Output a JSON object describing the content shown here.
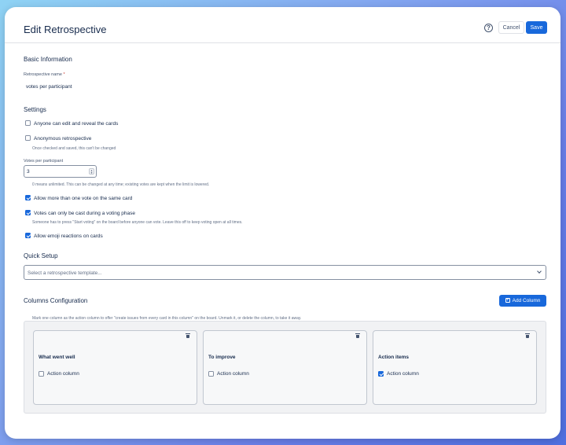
{
  "header": {
    "title": "Edit Retrospective",
    "help_icon": "?",
    "cancel_label": "Cancel",
    "save_label": "Save"
  },
  "basic": {
    "section_title": "Basic Information",
    "name_label": "Retrospective name",
    "required_mark": "*",
    "name_value": "votes per participant"
  },
  "settings": {
    "section_title": "Settings",
    "anyone_edit": {
      "label": "Anyone can edit and reveal the cards",
      "checked": false
    },
    "anonymous": {
      "label": "Anonymous retrospective",
      "checked": false,
      "helper": "Once checked and saved, this can't be changed"
    },
    "votes": {
      "label": "Votes per participant",
      "value": "3",
      "helper": "0 means unlimited. This can be changed at any time; existing votes are kept when the limit is lowered."
    },
    "multi_vote": {
      "label": "Allow more than one vote on the same card",
      "checked": true
    },
    "voting_phase": {
      "label": "Votes can only be cast during a voting phase",
      "checked": true,
      "helper": "Someone has to press \"Start voting\" on the board before anyone can vote. Leave this off to keep voting open at all times."
    },
    "emoji": {
      "label": "Allow emoji reactions on cards",
      "checked": true
    }
  },
  "quick_setup": {
    "section_title": "Quick Setup",
    "template_placeholder": "Select a retrospective template..."
  },
  "columns": {
    "section_title": "Columns Configuration",
    "add_label": "Add Column",
    "helper": "Mark one column as the action column to offer \"create issues from every card in this column\" on the board. Unmark it, or delete the column, to take it away.",
    "items": [
      {
        "title": "What went well",
        "action_label": "Action column",
        "is_action": false
      },
      {
        "title": "To improve",
        "action_label": "Action column",
        "is_action": false
      },
      {
        "title": "Action items",
        "action_label": "Action column",
        "is_action": true
      }
    ]
  },
  "colors": {
    "primary": "#1868db",
    "text": "#172b4d",
    "border": "#dfe1e6"
  }
}
